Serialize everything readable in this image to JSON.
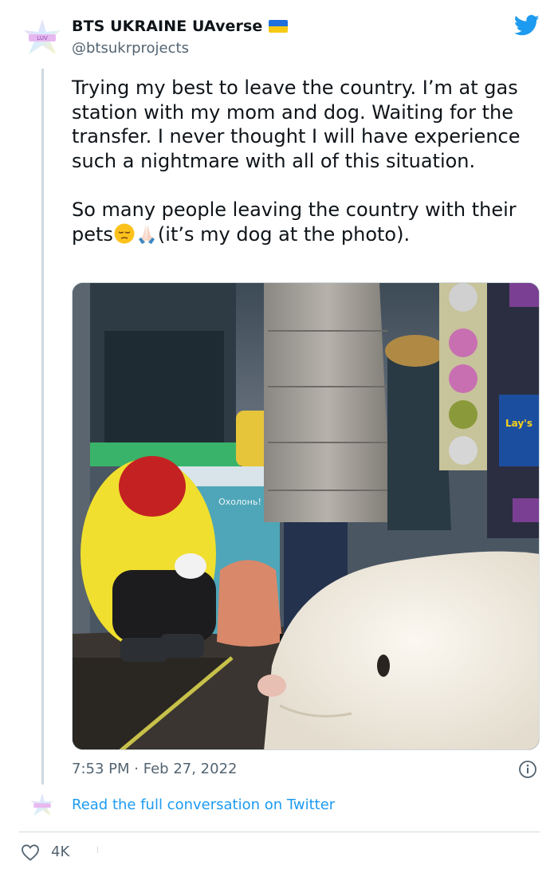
{
  "author": {
    "display_name": "BTS UKRAINE UAverse",
    "handle": "@btsukrprojects",
    "avatar_label": "LUV"
  },
  "tweet": {
    "paragraph_1": "Trying my best to leave the country. I’m at gas station with my mom and dog. Waiting for the transfer. I never thought I will have experience such a nightmare with all of this situation.",
    "paragraph_2_part1": "So many people leaving the country with their pets",
    "paragraph_2_part2": "(it’s my dog at the photo).",
    "emoji_1": "pensive-face",
    "emoji_2": "folded-hands"
  },
  "photo": {
    "fridge_sign": "Охолонь!",
    "chips_label": "Lay's"
  },
  "meta": {
    "time": "7:53 PM",
    "separator": "·",
    "date": "Feb 27, 2022"
  },
  "read_more": {
    "label": "Read the full conversation on Twitter"
  },
  "actions": {
    "like_count": "4K"
  },
  "colors": {
    "twitter_blue": "#1d9bf0",
    "text": "#0f1419",
    "secondary": "#536471",
    "border": "#cfd9de"
  }
}
